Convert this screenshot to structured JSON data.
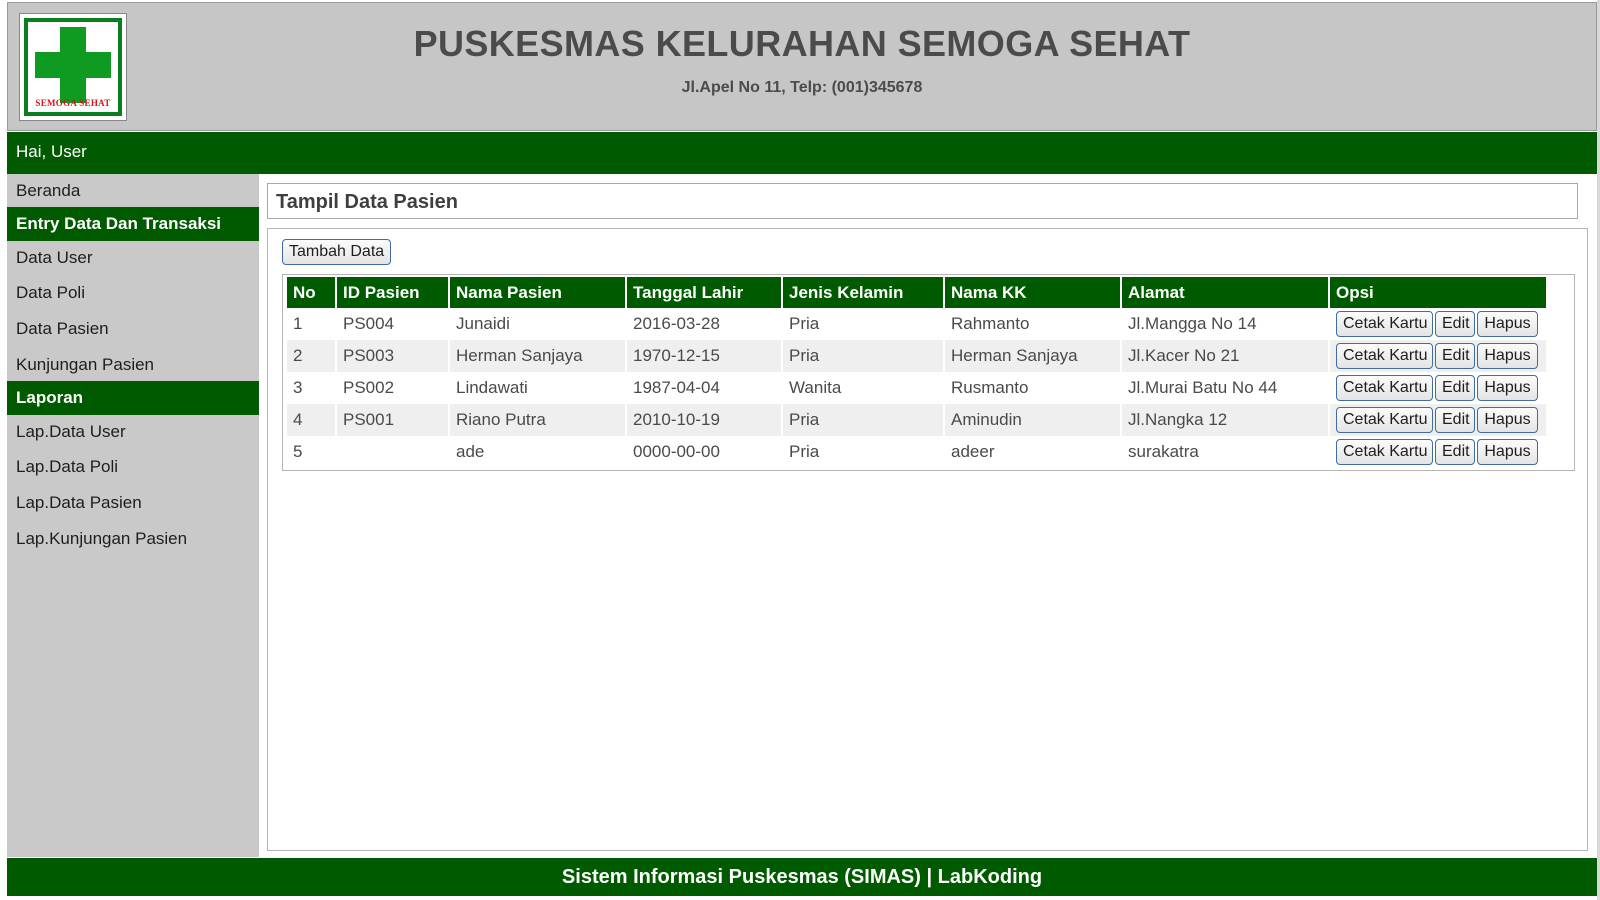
{
  "header": {
    "title": "PUSKESMAS KELURAHAN SEMOGA SEHAT",
    "address": "Jl.Apel No 11, Telp: (001)345678",
    "logo_text": "SEMOGA SEHAT",
    "logo_icon": "green-cross-icon"
  },
  "greeting": "Hai, User",
  "sidebar": {
    "items": [
      {
        "label": "Beranda",
        "type": "link"
      },
      {
        "label": "Entry Data Dan Transaksi",
        "type": "heading"
      },
      {
        "label": "Data User",
        "type": "link"
      },
      {
        "label": "Data Poli",
        "type": "link"
      },
      {
        "label": "Data Pasien",
        "type": "link"
      },
      {
        "label": "Kunjungan Pasien",
        "type": "link"
      },
      {
        "label": "Laporan",
        "type": "heading"
      },
      {
        "label": "Lap.Data User",
        "type": "link"
      },
      {
        "label": "Lap.Data Poli",
        "type": "link"
      },
      {
        "label": "Lap.Data Pasien",
        "type": "link"
      },
      {
        "label": "Lap.Kunjungan Pasien",
        "type": "link"
      }
    ]
  },
  "main": {
    "title": "Tampil Data Pasien",
    "add_button": "Tambah Data",
    "table": {
      "headers": [
        "No",
        "ID Pasien",
        "Nama Pasien",
        "Tanggal Lahir",
        "Jenis Kelamin",
        "Nama KK",
        "Alamat",
        "Opsi"
      ],
      "rows": [
        [
          "1",
          "PS004",
          "Junaidi",
          "2016-03-28",
          "Pria",
          "Rahmanto",
          "Jl.Mangga No 14"
        ],
        [
          "2",
          "PS003",
          "Herman Sanjaya",
          "1970-12-15",
          "Pria",
          "Herman Sanjaya",
          "Jl.Kacer No 21"
        ],
        [
          "3",
          "PS002",
          "Lindawati",
          "1987-04-04",
          "Wanita",
          "Rusmanto",
          "Jl.Murai Batu No 44"
        ],
        [
          "4",
          "PS001",
          "Riano Putra",
          "2010-10-19",
          "Pria",
          "Aminudin",
          "Jl.Nangka 12"
        ],
        [
          "5",
          "",
          "ade",
          "0000-00-00",
          "Pria",
          "adeer",
          "surakatra"
        ]
      ],
      "actions": {
        "print": "Cetak Kartu",
        "edit": "Edit",
        "delete": "Hapus"
      }
    }
  },
  "footer": "Sistem Informasi Puskesmas (SIMAS) | LabKoding",
  "colors": {
    "primary_green": "#005b00",
    "header_bg": "#c6c6c6",
    "sidebar_bg": "#c9c9c9",
    "row_alt": "#efefef",
    "button_border": "#3f6da3"
  }
}
